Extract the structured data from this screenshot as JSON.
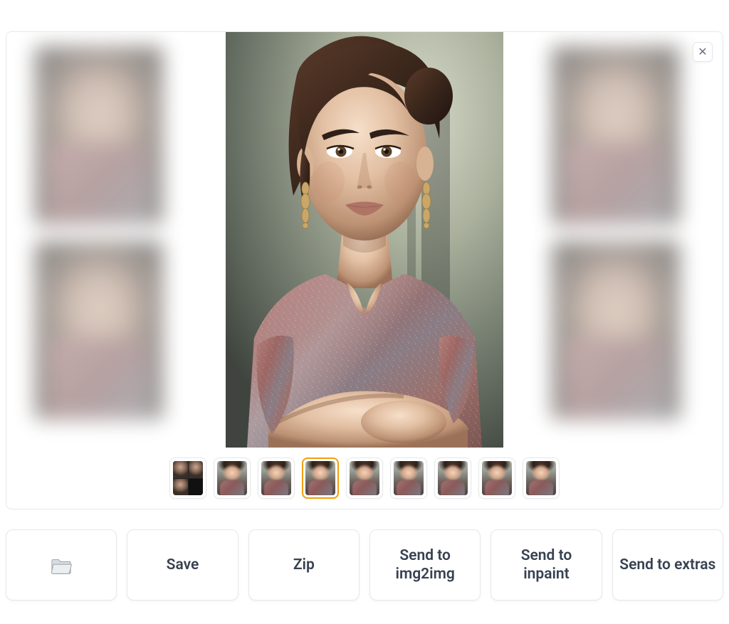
{
  "viewer": {
    "close_label": "✕",
    "thumbnails": [
      {
        "name": "thumbnail-1",
        "kind": "grid",
        "selected": false
      },
      {
        "name": "thumbnail-2",
        "kind": "portrait",
        "selected": false
      },
      {
        "name": "thumbnail-3",
        "kind": "portrait",
        "selected": false
      },
      {
        "name": "thumbnail-4",
        "kind": "portrait",
        "selected": true
      },
      {
        "name": "thumbnail-5",
        "kind": "portrait",
        "selected": false
      },
      {
        "name": "thumbnail-6",
        "kind": "portrait",
        "selected": false
      },
      {
        "name": "thumbnail-7",
        "kind": "portrait",
        "selected": false
      },
      {
        "name": "thumbnail-8",
        "kind": "portrait",
        "selected": false
      },
      {
        "name": "thumbnail-9",
        "kind": "portrait",
        "selected": false
      }
    ]
  },
  "actions": {
    "folder_label": "📁",
    "save_label": "Save",
    "zip_label": "Zip",
    "img2img_label": "Send to img2img",
    "inpaint_label": "Send to inpaint",
    "extras_label": "Send to extras"
  }
}
